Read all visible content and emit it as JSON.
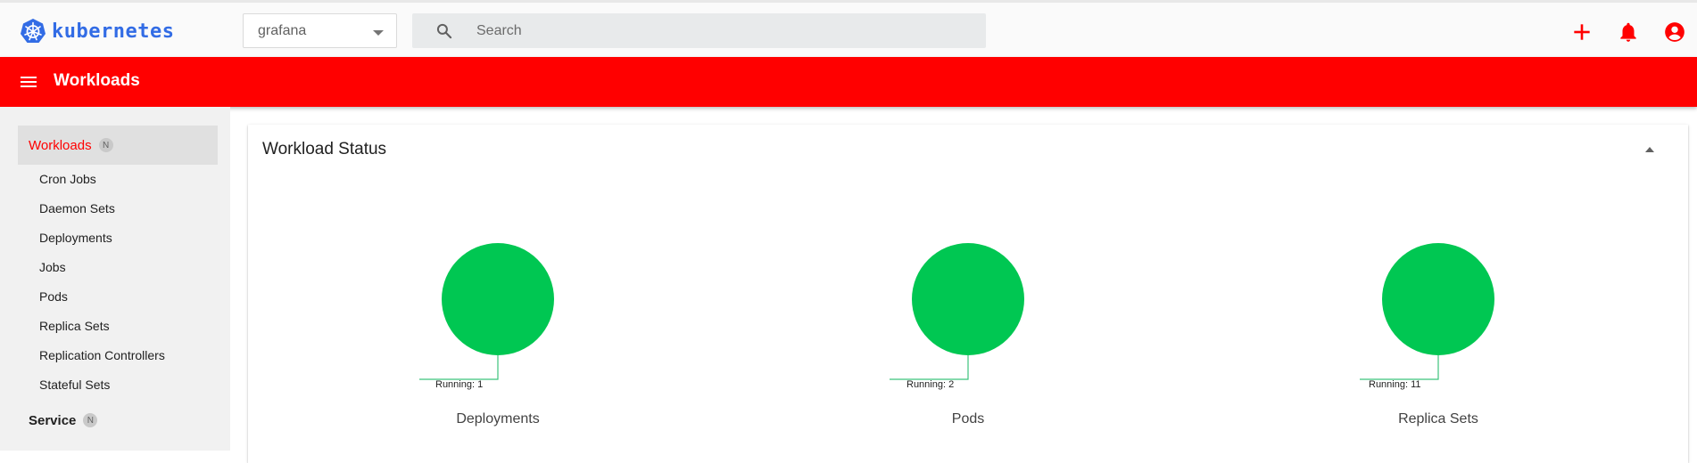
{
  "app": {
    "logo_text": "kubernetes",
    "brand_color": "#326ce5"
  },
  "header": {
    "namespace_value": "grafana",
    "search_placeholder": "Search",
    "icons": [
      "add-icon",
      "notifications-icon",
      "account-icon"
    ],
    "icon_color": "#ff0000"
  },
  "toolbar": {
    "title": "Workloads",
    "color": "#ff0000"
  },
  "sidebar": {
    "sections": [
      {
        "label": "Workloads",
        "badge": "N",
        "active": true
      },
      {
        "label": "Service",
        "badge": "N",
        "active": false
      }
    ],
    "items": [
      {
        "label": "Cron Jobs"
      },
      {
        "label": "Daemon Sets"
      },
      {
        "label": "Deployments"
      },
      {
        "label": "Jobs"
      },
      {
        "label": "Pods"
      },
      {
        "label": "Replica Sets"
      },
      {
        "label": "Replication Controllers"
      },
      {
        "label": "Stateful Sets"
      }
    ]
  },
  "main": {
    "card_title": "Workload Status"
  },
  "chart_data": [
    {
      "type": "pie",
      "title": "Deployments",
      "series": [
        {
          "name": "Running",
          "values": [
            1
          ]
        }
      ],
      "labels": [
        "Running: 1"
      ],
      "colors": [
        "#00c752"
      ]
    },
    {
      "type": "pie",
      "title": "Pods",
      "series": [
        {
          "name": "Running",
          "values": [
            2
          ]
        }
      ],
      "labels": [
        "Running: 2"
      ],
      "colors": [
        "#00c752"
      ]
    },
    {
      "type": "pie",
      "title": "Replica Sets",
      "series": [
        {
          "name": "Running",
          "values": [
            11
          ]
        }
      ],
      "labels": [
        "Running: 11"
      ],
      "colors": [
        "#00c752"
      ]
    }
  ]
}
